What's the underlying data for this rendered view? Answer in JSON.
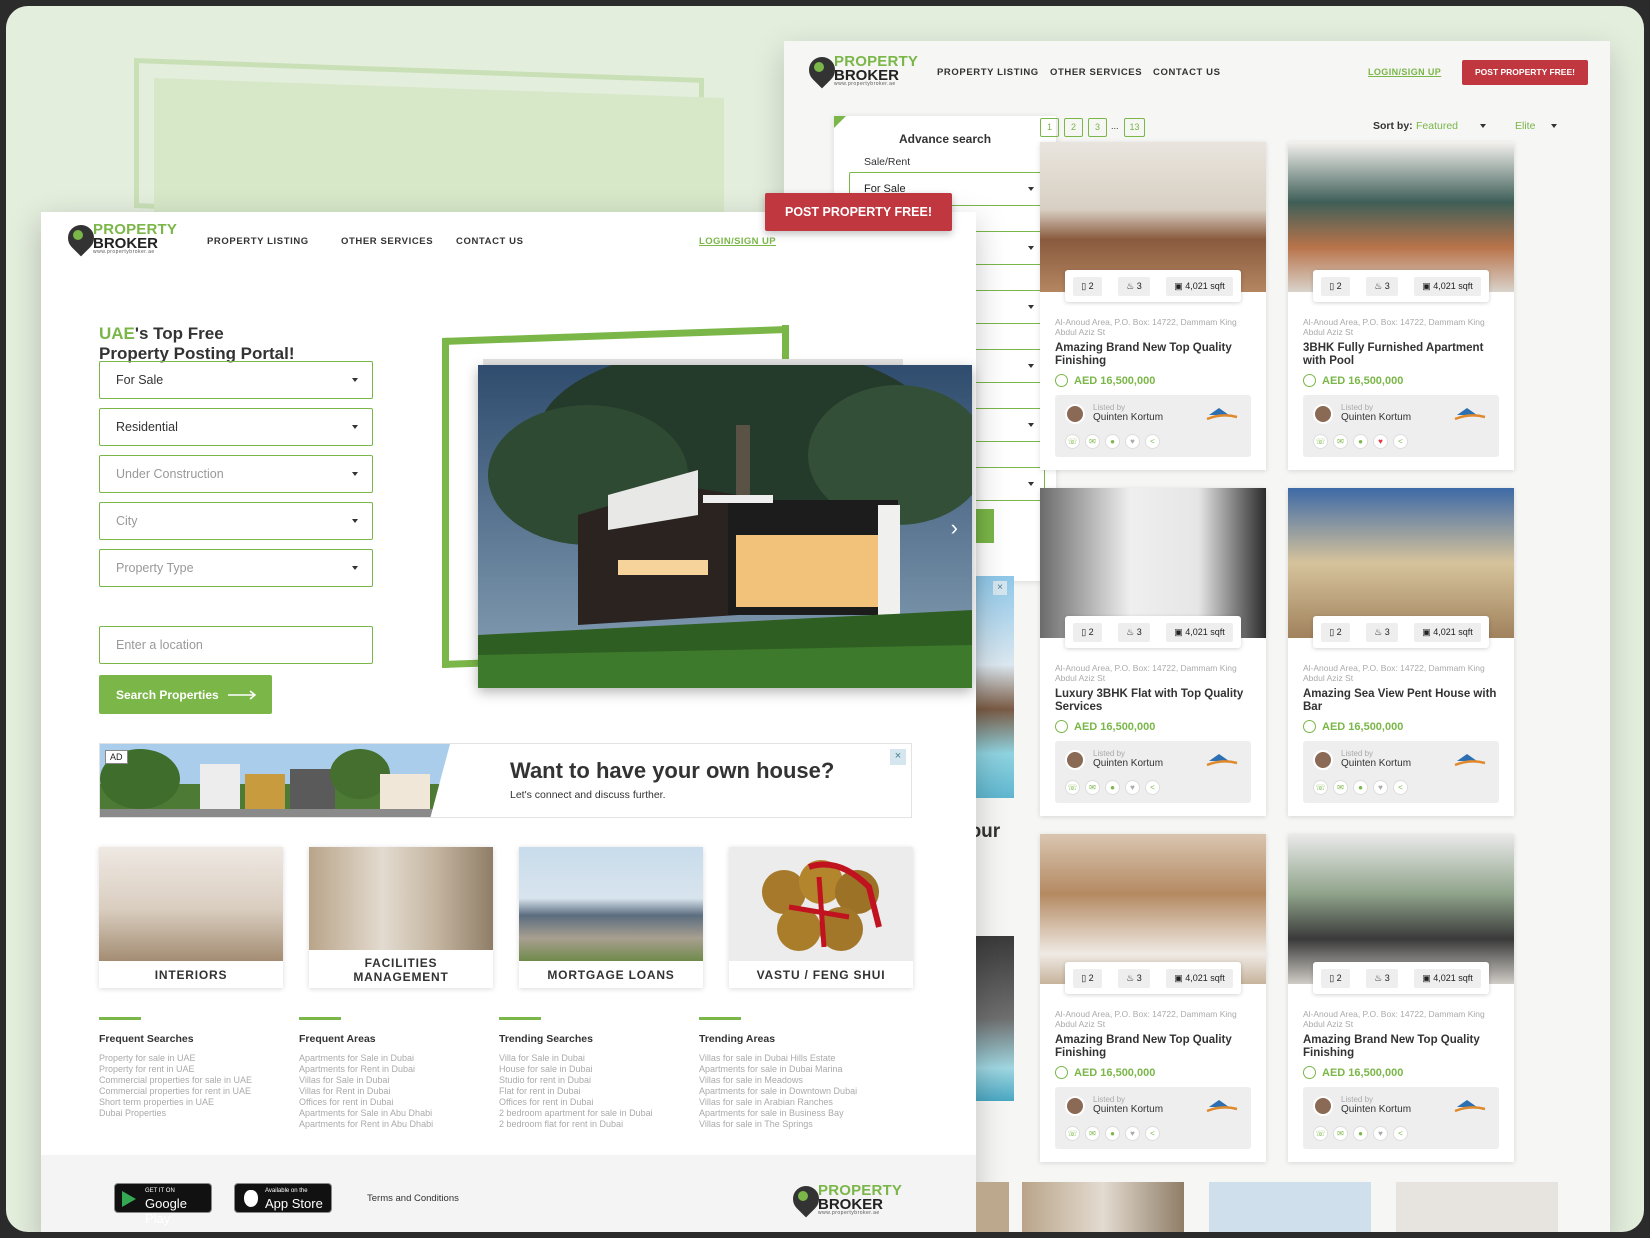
{
  "listing_page": {
    "brand": {
      "word1": "PROPERTY",
      "word2": "BROKER",
      "url": "www.propertybroker.ae"
    },
    "nav": [
      "PROPERTY LISTING",
      "OTHER SERVICES",
      "CONTACT US"
    ],
    "login": "LOGIN/SIGN UP",
    "post_btn": "POST PROPERTY FREE!",
    "advance_search": {
      "title": "Advance search",
      "sale_rent_label": "Sale/Rent",
      "sale_rent_value": "For Sale"
    },
    "pagination": [
      "1",
      "2",
      "3",
      "...",
      "13"
    ],
    "sort": {
      "label": "Sort by:",
      "value": "Featured",
      "second": "Elite"
    },
    "partial_text": "your",
    "cards": [
      {
        "beds": "2",
        "baths": "3",
        "area": "4,021 sqft",
        "address": "Al-Anoud Area, P.O. Box: 14722, Dammam King Abdul Aziz St",
        "title": "Amazing Brand New Top Quality Finishing",
        "price": "AED 16,500,000",
        "listed_by": "Listed by",
        "agent": "Quinten Kortum"
      },
      {
        "beds": "2",
        "baths": "3",
        "area": "4,021 sqft",
        "address": "Al-Anoud Area, P.O. Box: 14722, Dammam King Abdul Aziz St",
        "title": "3BHK Fully Furnished Apartment with Pool",
        "price": "AED 16,500,000",
        "listed_by": "Listed by",
        "agent": "Quinten Kortum"
      },
      {
        "beds": "2",
        "baths": "3",
        "area": "4,021 sqft",
        "address": "Al-Anoud Area, P.O. Box: 14722, Dammam King Abdul Aziz St",
        "title": "Luxury 3BHK Flat with Top Quality Services",
        "price": "AED 16,500,000",
        "listed_by": "Listed by",
        "agent": "Quinten Kortum"
      },
      {
        "beds": "2",
        "baths": "3",
        "area": "4,021 sqft",
        "address": "Al-Anoud Area, P.O. Box: 14722, Dammam King Abdul Aziz St",
        "title": "Amazing Sea View Pent House with Bar",
        "price": "AED 16,500,000",
        "listed_by": "Listed by",
        "agent": "Quinten Kortum"
      },
      {
        "beds": "2",
        "baths": "3",
        "area": "4,021 sqft",
        "address": "Al-Anoud Area, P.O. Box: 14722, Dammam King Abdul Aziz St",
        "title": "Amazing Brand New Top Quality Finishing",
        "price": "AED 16,500,000",
        "listed_by": "Listed by",
        "agent": "Quinten Kortum"
      },
      {
        "beds": "2",
        "baths": "3",
        "area": "4,021 sqft",
        "address": "Al-Anoud Area, P.O. Box: 14722, Dammam King Abdul Aziz St",
        "title": "Amazing Brand New Top Quality Finishing",
        "price": "AED 16,500,000",
        "listed_by": "Listed by",
        "agent": "Quinten Kortum"
      }
    ]
  },
  "home_page": {
    "brand": {
      "word1": "PROPERTY",
      "word2": "BROKER",
      "url": "www.propertybroker.ae"
    },
    "nav": [
      "PROPERTY LISTING",
      "OTHER SERVICES",
      "CONTACT US"
    ],
    "login": "LOGIN/SIGN UP",
    "post_btn": "POST PROPERTY FREE!",
    "heading_accent": "UAE",
    "heading_rest": "'s Top Free",
    "heading_line2": "Property Posting Portal!",
    "filters": [
      {
        "value": "For Sale",
        "placeholder": false
      },
      {
        "value": "Residential",
        "placeholder": false
      },
      {
        "value": "Under Construction",
        "placeholder": true
      },
      {
        "value": "City",
        "placeholder": true
      },
      {
        "value": "Property Type",
        "placeholder": true
      }
    ],
    "location_placeholder": "Enter a location",
    "search_btn": "Search Properties",
    "ad": {
      "badge": "AD",
      "title": "Want to have your own house?",
      "subtitle": "Let's connect and discuss further.",
      "close": "x"
    },
    "services": [
      "INTERIORS",
      "FACILITIES MANAGEMENT",
      "MORTGAGE LOANS",
      "VASTU / FENG SHUI"
    ],
    "link_columns": [
      {
        "title": "Frequent Searches",
        "links": [
          "Property for sale in UAE",
          "Property for rent in UAE",
          "Commercial properties for sale in UAE",
          "Commercial properties for rent in UAE",
          "Short term properties in UAE",
          "Dubai Properties"
        ]
      },
      {
        "title": "Frequent Areas",
        "links": [
          "Apartments for Sale in Dubai",
          "Apartments for Rent in Dubai",
          "Villas for Sale in Dubai",
          "Villas for Rent in Dubai",
          "Offices for rent in Dubai",
          "Apartments for Sale in Abu Dhabi",
          "Apartments for Rent in Abu Dhabi"
        ]
      },
      {
        "title": "Trending Searches",
        "links": [
          "Villa for Sale in Dubai",
          "House for sale in Dubai",
          "Studio for rent in Dubai",
          "Flat for rent in Dubai",
          "Offices for rent in Dubai",
          "2 bedroom apartment for sale in Dubai",
          "2 bedroom flat for rent in Dubai"
        ]
      },
      {
        "title": "Trending Areas",
        "links": [
          "Villas for sale in Dubai Hills Estate",
          "Apartments for sale in Dubai Marina",
          "Villas for sale in Meadows",
          "Apartments for sale in Downtown Dubai",
          "Villas for sale in Arabian Ranches",
          "Apartments for sale in Business Bay",
          "Villas for sale in The Springs"
        ]
      }
    ],
    "footer": {
      "google_small": "GET IT ON",
      "google_big": "Google Play",
      "apple_small": "Available on the",
      "apple_big": "App Store",
      "terms": "Terms and Conditions"
    }
  },
  "colors": {
    "accent": "#7ab648",
    "cta": "#c0373f",
    "background": "#e4eedd"
  }
}
